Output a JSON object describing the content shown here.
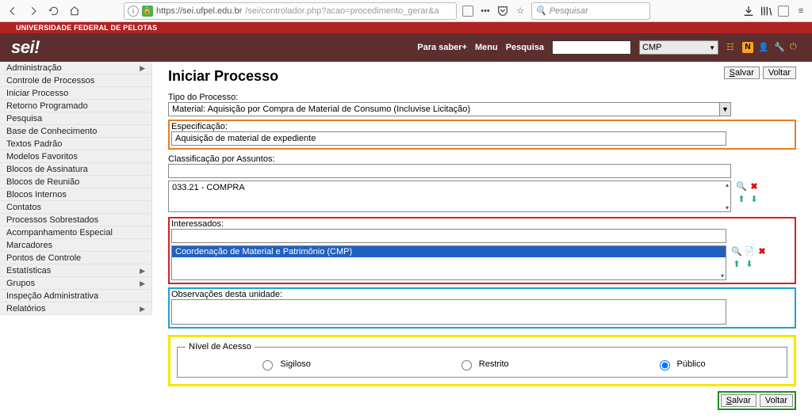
{
  "browser": {
    "url_host": "https://sei.ufpel.edu.br",
    "url_path": "/sei/controlador.php?acao=procedimento_gerar&a",
    "search_placeholder": "Pesquisar"
  },
  "university_bar": "UNIVERSIDADE FEDERAL DE PELOTAS",
  "header": {
    "logo": "sei!",
    "links": {
      "para_saber": "Para saber+",
      "menu": "Menu",
      "pesquisa": "Pesquisa"
    },
    "unit_selected": "CMP"
  },
  "sidebar": {
    "items": [
      {
        "label": "Administração",
        "submenu": true
      },
      {
        "label": "Controle de Processos",
        "submenu": false
      },
      {
        "label": "Iniciar Processo",
        "submenu": false
      },
      {
        "label": "Retorno Programado",
        "submenu": false
      },
      {
        "label": "Pesquisa",
        "submenu": false
      },
      {
        "label": "Base de Conhecimento",
        "submenu": false
      },
      {
        "label": "Textos Padrão",
        "submenu": false
      },
      {
        "label": "Modelos Favoritos",
        "submenu": false
      },
      {
        "label": "Blocos de Assinatura",
        "submenu": false
      },
      {
        "label": "Blocos de Reunião",
        "submenu": false
      },
      {
        "label": "Blocos Internos",
        "submenu": false
      },
      {
        "label": "Contatos",
        "submenu": false
      },
      {
        "label": "Processos Sobrestados",
        "submenu": false
      },
      {
        "label": "Acompanhamento Especial",
        "submenu": false
      },
      {
        "label": "Marcadores",
        "submenu": false
      },
      {
        "label": "Pontos de Controle",
        "submenu": false
      },
      {
        "label": "Estatísticas",
        "submenu": true
      },
      {
        "label": "Grupos",
        "submenu": true
      },
      {
        "label": "Inspeção Administrativa",
        "submenu": false
      },
      {
        "label": "Relatórios",
        "submenu": true
      }
    ]
  },
  "page": {
    "title": "Iniciar Processo",
    "buttons": {
      "salvar": "Salvar",
      "voltar": "Voltar"
    },
    "labels": {
      "tipo": "Tipo do Processo:",
      "especificacao": "Especificação:",
      "classificacao": "Classificação por Assuntos:",
      "interessados": "Interessados:",
      "observacoes": "Observações desta unidade:",
      "nivel": "Nível de Acesso"
    },
    "fields": {
      "tipo_value": "Material: Aquisição por Compra de Material de Consumo (Incluvise Licitação)",
      "especificacao_value": "Aquisição de material de expediente",
      "classificacao_input": "",
      "classificacao_item": "033.21 - COMPRA",
      "interessados_input": "",
      "interessados_item": "Coordenação de Material e Patrimônio (CMP)",
      "observacoes_value": ""
    },
    "access": {
      "sigiloso": "Sigiloso",
      "restrito": "Restrito",
      "publico": "Público",
      "selected": "publico"
    }
  }
}
